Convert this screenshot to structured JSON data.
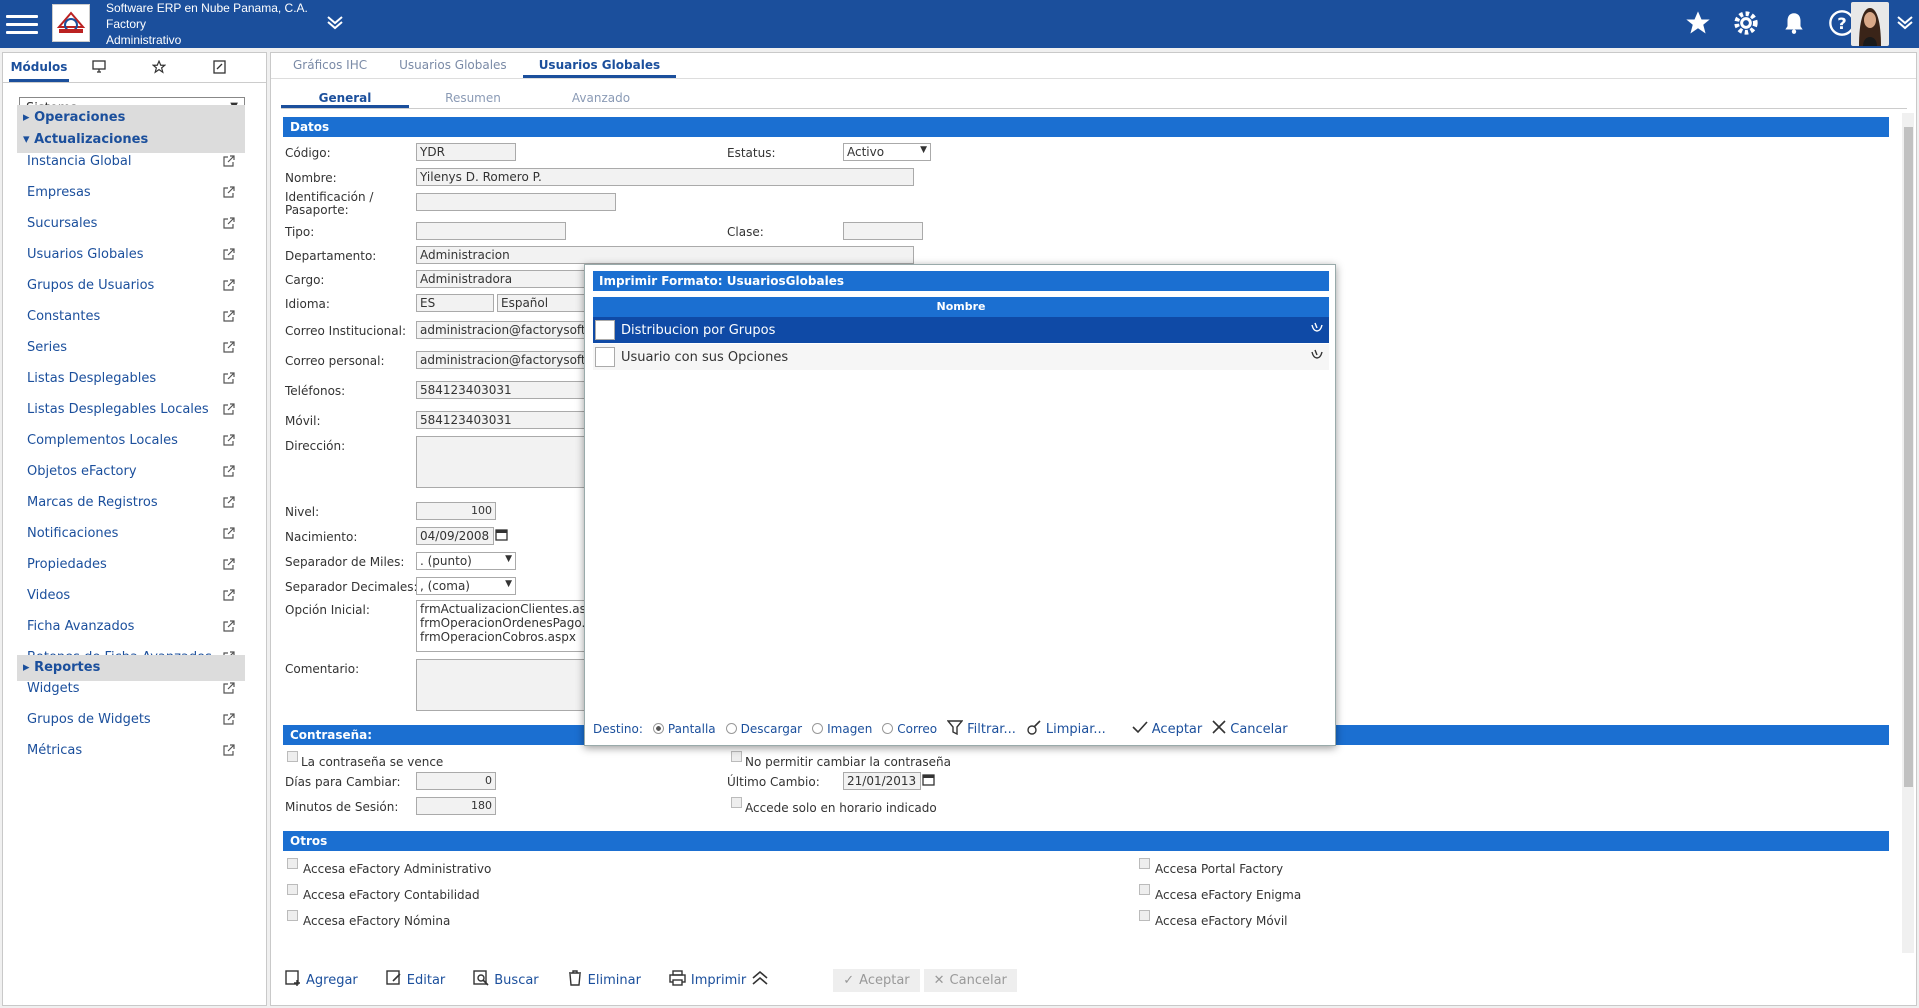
{
  "app": {
    "company_line1": "Software ERP en Nube Panama, C.A.",
    "company_line2": "Factory",
    "company_line3": "Administrativo"
  },
  "left_panel": {
    "tabs": [
      "Módulos"
    ],
    "select_value": "Sistema",
    "groups": [
      "Operaciones",
      "Actualizaciones",
      "Reportes"
    ],
    "items": [
      "Instancia Global",
      "Empresas",
      "Sucursales",
      "Usuarios Globales",
      "Grupos de Usuarios",
      "Constantes",
      "Series",
      "Listas Desplegables",
      "Listas Desplegables Locales",
      "Complementos Locales",
      "Objetos eFactory",
      "Marcas de Registros",
      "Notificaciones",
      "Propiedades",
      "Videos",
      "Ficha Avanzados",
      "Botones de Ficha Avanzados",
      "Widgets",
      "Grupos de Widgets",
      "Métricas"
    ]
  },
  "main_tabs": [
    "Gráficos IHC",
    "Usuarios Globales",
    "Usuarios Globales"
  ],
  "sub_tabs": [
    "General",
    "Resumen",
    "Avanzado"
  ],
  "sections": {
    "datos": "Datos",
    "contrasena": "Contraseña:",
    "otros": "Otros"
  },
  "form": {
    "codigo_label": "Código:",
    "codigo": "YDR",
    "estatus_label": "Estatus:",
    "estatus": "Activo",
    "nombre_label": "Nombre:",
    "nombre": "Yilenys D. Romero P.",
    "ident_label1": "Identificación /",
    "ident_label2": "Pasaporte:",
    "tipo_label": "Tipo:",
    "clase_label": "Clase:",
    "depto_label": "Departamento:",
    "depto": "Administracion",
    "cargo_label": "Cargo:",
    "cargo": "Administradora",
    "idioma_label": "Idioma:",
    "idioma_code": "ES",
    "idioma_name": "Español",
    "correo_inst_label": "Correo Institucional:",
    "correo_inst": "administracion@factorysoft",
    "correo_pers_label": "Correo personal:",
    "correo_pers": "administracion@factorysoft",
    "telefonos_label": "Teléfonos:",
    "telefonos": "584123403031",
    "movil_label": "Móvil:",
    "movil": "584123403031",
    "direccion_label": "Dirección:",
    "nivel_label": "Nivel:",
    "nivel": "100",
    "nacimiento_label": "Nacimiento:",
    "nacimiento": "04/09/2008",
    "sep_miles_label": "Separador de Miles:",
    "sep_miles": ". (punto)",
    "sep_dec_label": "Separador Decimales:",
    "sep_dec": ", (coma)",
    "opcion_label": "Opción Inicial:",
    "opcion_lines": [
      "frmActualizacionClientes.as",
      "frmOperacionOrdenesPago.",
      "frmOperacionCobros.aspx"
    ],
    "comentario_label": "Comentario:"
  },
  "password": {
    "vence": "La contraseña se vence",
    "no_cambiar": "No permitir cambiar la contraseña",
    "dias_label": "Días para Cambiar:",
    "dias": "0",
    "ultimo_label": "Último Cambio:",
    "ultimo": "21/01/2013",
    "minutos_label": "Minutos de Sesión:",
    "minutos": "180",
    "horario": "Accede solo en horario indicado"
  },
  "otros": {
    "left": [
      "Accesa eFactory Administrativo",
      "Accesa eFactory Contabilidad",
      "Accesa eFactory Nómina"
    ],
    "right": [
      "Accesa Portal Factory",
      "Accesa eFactory Enigma",
      "Accesa eFactory Móvil"
    ]
  },
  "toolbar": {
    "agregar": "Agregar",
    "editar": "Editar",
    "buscar": "Buscar",
    "eliminar": "Eliminar",
    "imprimir": "Imprimir",
    "aceptar": "Aceptar",
    "cancelar": "Cancelar"
  },
  "modal": {
    "title": "Imprimir Formato: UsuariosGlobales",
    "column": "Nombre",
    "rows": [
      "Distribucion por Grupos",
      "Usuario con sus Opciones"
    ],
    "destino_label": "Destino:",
    "destinos": [
      "Pantalla",
      "Descargar",
      "Imagen",
      "Correo"
    ],
    "filtrar": "Filtrar...",
    "limpiar": "Limpiar...",
    "aceptar": "Aceptar",
    "cancelar": "Cancelar"
  },
  "colors": {
    "primary": "#1b4f9c",
    "section": "#1b6fd1",
    "selected_row": "#0f4aa6"
  }
}
